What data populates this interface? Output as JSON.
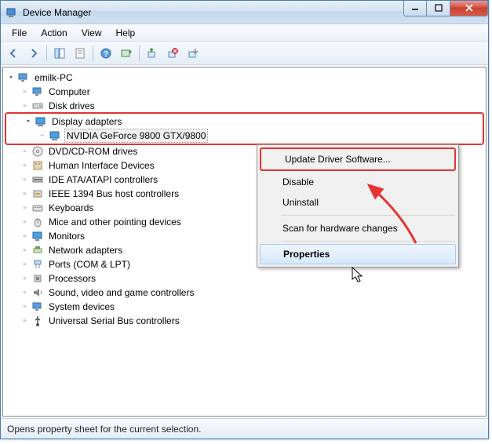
{
  "title": "Device Manager",
  "menus": {
    "file": "File",
    "action": "Action",
    "view": "View",
    "help": "Help"
  },
  "root_node": "emilk-PC",
  "categories": [
    "Computer",
    "Disk drives",
    "Display adapters",
    "DVD/CD-ROM drives",
    "Human Interface Devices",
    "IDE ATA/ATAPI controllers",
    "IEEE 1394 Bus host controllers",
    "Keyboards",
    "Mice and other pointing devices",
    "Monitors",
    "Network adapters",
    "Ports (COM & LPT)",
    "Processors",
    "Sound, video and game controllers",
    "System devices",
    "Universal Serial Bus controllers"
  ],
  "display_adapter_child": "NVIDIA GeForce 9800 GTX/9800",
  "context_menu": {
    "update": "Update Driver Software...",
    "disable": "Disable",
    "uninstall": "Uninstall",
    "scan": "Scan for hardware changes",
    "properties": "Properties"
  },
  "statusbar": "Opens property sheet for the current selection."
}
